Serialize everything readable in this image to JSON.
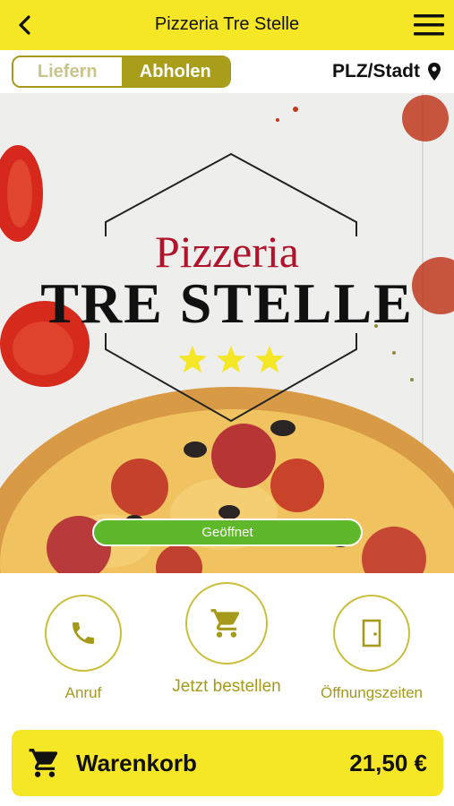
{
  "header": {
    "title": "Pizzeria Tre Stelle",
    "back_icon": "chevron-left-icon",
    "menu_icon": "hamburger-menu-icon"
  },
  "mode_toggle": {
    "options": [
      "Liefern",
      "Abholen"
    ],
    "selected": "Abholen"
  },
  "location": {
    "label": "PLZ/Stadt",
    "icon": "location-pin-icon"
  },
  "hero": {
    "logo_line1": "Pizzeria",
    "logo_line2": "TRE STELLE",
    "stars": 3,
    "status": "Geöffnet"
  },
  "colors": {
    "brand_yellow": "#f5e626",
    "accent_olive": "#a89e1a",
    "logo_red": "#b0142c",
    "status_green": "#5fb829"
  },
  "actions": [
    {
      "label": "Anruf",
      "icon": "phone-icon"
    },
    {
      "label": "Jetzt bestellen",
      "icon": "shopping-cart-icon"
    },
    {
      "label": "Öffnungszeiten",
      "icon": "door-icon"
    }
  ],
  "cart": {
    "label": "Warenkorb",
    "total": "21,50 €",
    "icon": "shopping-cart-icon"
  }
}
